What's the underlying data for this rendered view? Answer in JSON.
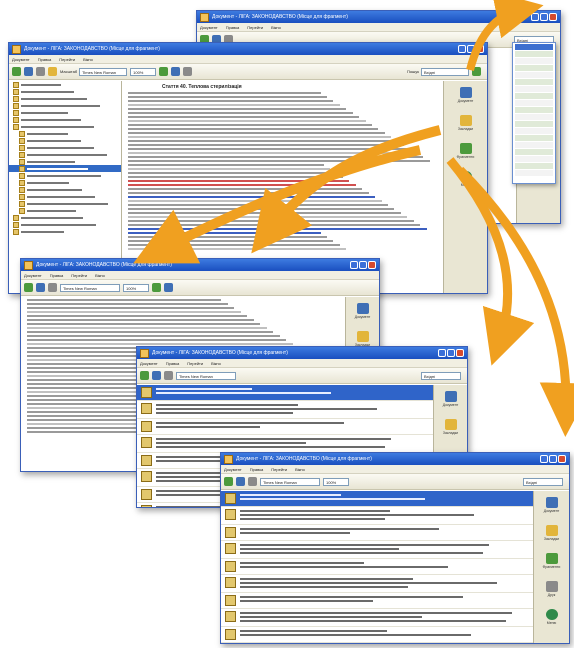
{
  "windows": {
    "back": {
      "title": "Документ - ЛІГА: ЗАКОНОДАВСТВО (Місце для фрагмент)",
      "search_value": "Вхідні"
    },
    "main": {
      "title": "Документ - ЛІГА: ЗАКОНОДАВСТВО (Місце для фрагмент)",
      "menu": [
        "Документ",
        "Правка",
        "Перейти",
        "Вікно"
      ],
      "toolbar": {
        "font_label": "Масштаб",
        "font_value": "Times New Roman",
        "zoom_value": "100%",
        "search_label": "Пошук",
        "search_value": "Вхідні"
      },
      "article_heading": "Стаття 40. Теплова стерилізація",
      "tree_items": 22,
      "side_buttons": [
        "Документ",
        "Закладки",
        "Фрагменти",
        "Меню"
      ]
    },
    "third": {
      "title": "Документ - ЛІГА: ЗАКОНОДАВСТВО (Місце для фрагмент)",
      "menu": [
        "Документ",
        "Правка",
        "Перейти",
        "Вікно"
      ],
      "side_buttons": [
        "Документ",
        "Закладки"
      ]
    },
    "fourth": {
      "title": "Документ - ЛІГА: ЗАКОНОДАВСТВО (Місце для фрагмент)",
      "menu": [
        "Документ",
        "Правка",
        "Перейти",
        "Вікно"
      ],
      "side_buttons": [
        "Документ",
        "Закладки"
      ]
    },
    "front": {
      "title": "Документ - ЛІГА: ЗАКОНОДАВСТВО (Місце для фрагмент)",
      "menu": [
        "Документ",
        "Правка",
        "Перейти",
        "Вікно"
      ],
      "side_buttons": [
        "Документ",
        "Закладки",
        "Фрагменти",
        "Друк",
        "Меню"
      ]
    }
  },
  "colors": {
    "arrow": "#f0a020",
    "titlebar": "#2456c8",
    "selection": "#2f64c9"
  },
  "icons": [
    "curved-arrow-icon",
    "save-icon",
    "print-icon",
    "search-icon",
    "document-icon",
    "bookmark-icon",
    "close-icon"
  ]
}
